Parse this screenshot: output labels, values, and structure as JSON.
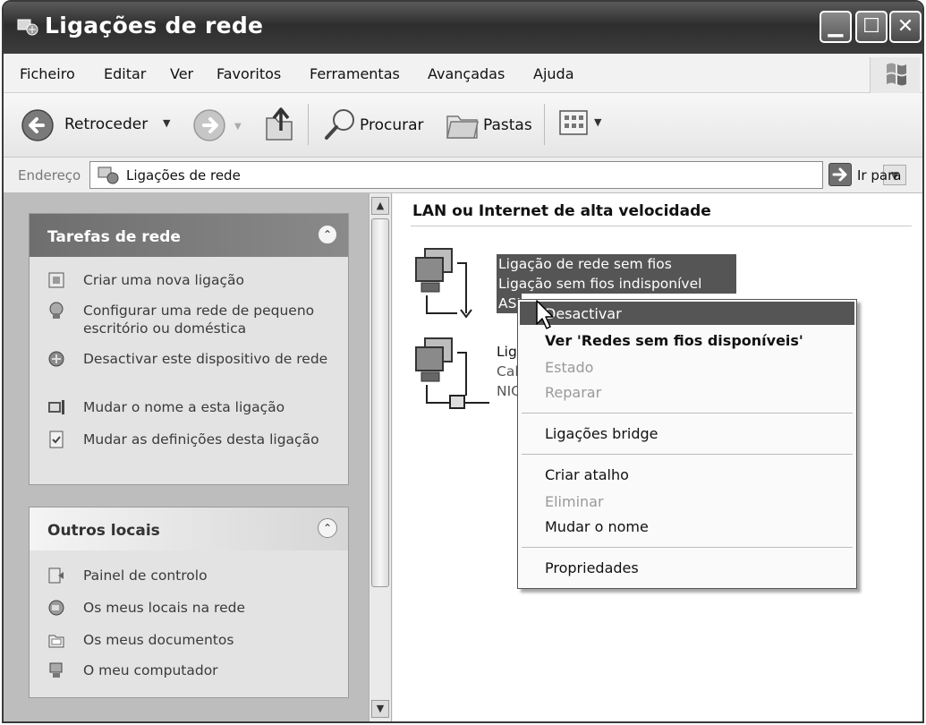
{
  "window": {
    "title": "Ligações de rede"
  },
  "menubar": {
    "items": [
      "Ficheiro",
      "Editar",
      "Ver",
      "Favoritos",
      "Ferramentas",
      "Avançadas",
      "Ajuda"
    ]
  },
  "toolbar": {
    "back_label": "Retroceder",
    "search_label": "Procurar",
    "folders_label": "Pastas"
  },
  "address": {
    "label": "Endereço",
    "value": "Ligações de rede",
    "go_label": "Ir para"
  },
  "left_pane": {
    "network_tasks": {
      "title": "Tarefas de rede",
      "items": [
        {
          "label": "Criar uma nova ligação",
          "icon": "new-connection-icon"
        },
        {
          "label": "Configurar uma rede de pequeno escritório ou doméstica",
          "icon": "home-network-icon"
        },
        {
          "label": "Desactivar este dispositivo de rede",
          "icon": "disable-device-icon"
        },
        {
          "label": "Mudar o nome a esta ligação",
          "icon": "rename-icon"
        },
        {
          "label": "Mudar as definições desta ligação",
          "icon": "settings-icon"
        }
      ]
    },
    "other_places": {
      "title": "Outros locais",
      "items": [
        {
          "label": "Painel de controlo",
          "icon": "control-panel-icon"
        },
        {
          "label": "Os meus locais na rede",
          "icon": "network-places-icon"
        },
        {
          "label": "Os meus documentos",
          "icon": "documents-icon"
        },
        {
          "label": "O meu computador",
          "icon": "computer-icon"
        }
      ]
    }
  },
  "content": {
    "group_title": "LAN ou Internet de alta velocidade",
    "connections": [
      {
        "lines": [
          "Ligação de rede sem fios",
          "Ligação sem fios indisponível",
          "ASU"
        ],
        "icon": "wireless-network-icon",
        "selected": true
      },
      {
        "lines": [
          "Lig",
          "Cal",
          "NIC"
        ],
        "icon": "lan-network-icon",
        "selected": false
      }
    ]
  },
  "context_menu": {
    "items": [
      {
        "label": "Desactivar",
        "state": "highlighted"
      },
      {
        "label": "Ver 'Redes sem fios disponíveis'",
        "state": "default"
      },
      {
        "label": "Estado",
        "state": "disabled"
      },
      {
        "label": "Reparar",
        "state": "disabled"
      },
      {
        "label": "Ligações bridge",
        "state": "normal"
      },
      {
        "label": "Criar atalho",
        "state": "normal"
      },
      {
        "label": "Eliminar",
        "state": "disabled"
      },
      {
        "label": "Mudar o nome",
        "state": "normal"
      },
      {
        "label": "Propriedades",
        "state": "normal"
      }
    ]
  }
}
